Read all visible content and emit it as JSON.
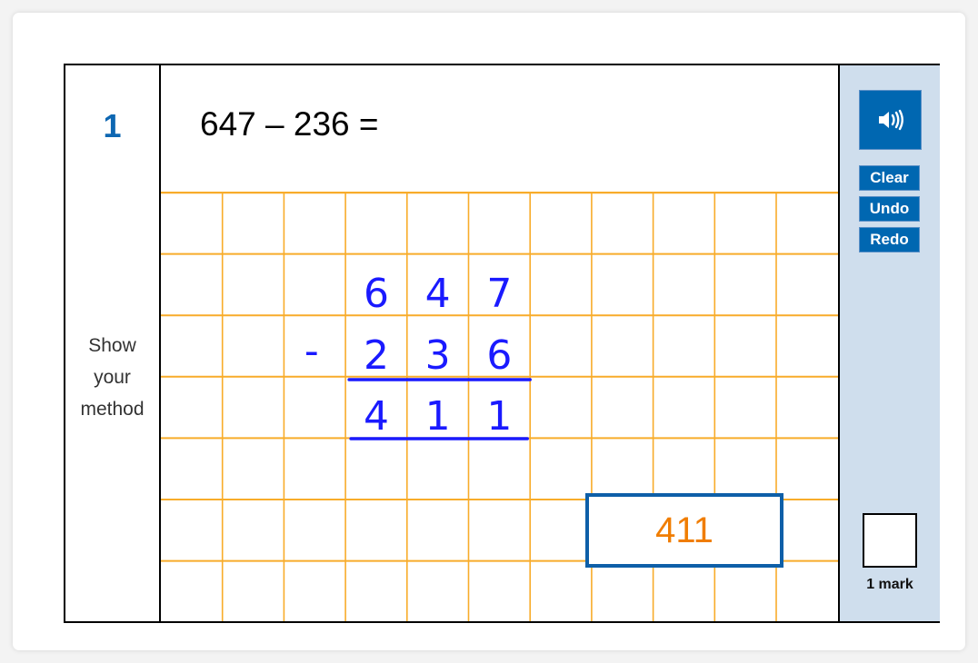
{
  "question": {
    "number": "1",
    "text": "647 – 236 =",
    "prompt_lines": [
      "Show",
      "your",
      "method"
    ]
  },
  "working": {
    "row_top": [
      "6",
      "4",
      "7"
    ],
    "operator": "-",
    "row_bottom": [
      "2",
      "3",
      "6"
    ],
    "result": [
      "4",
      "1",
      "1"
    ],
    "ink_color": "#1a1aff",
    "grid_color": "#f8ac2a"
  },
  "answer": {
    "value": "411",
    "text_color": "#f07d00",
    "border_color": "#0e5fa8"
  },
  "sidebar": {
    "audio_icon": "speaker-icon",
    "buttons": {
      "clear": "Clear",
      "undo": "Undo",
      "redo": "Redo"
    },
    "marks_label": "1 mark",
    "accent": "#0067b1",
    "background": "#cfdeed"
  }
}
